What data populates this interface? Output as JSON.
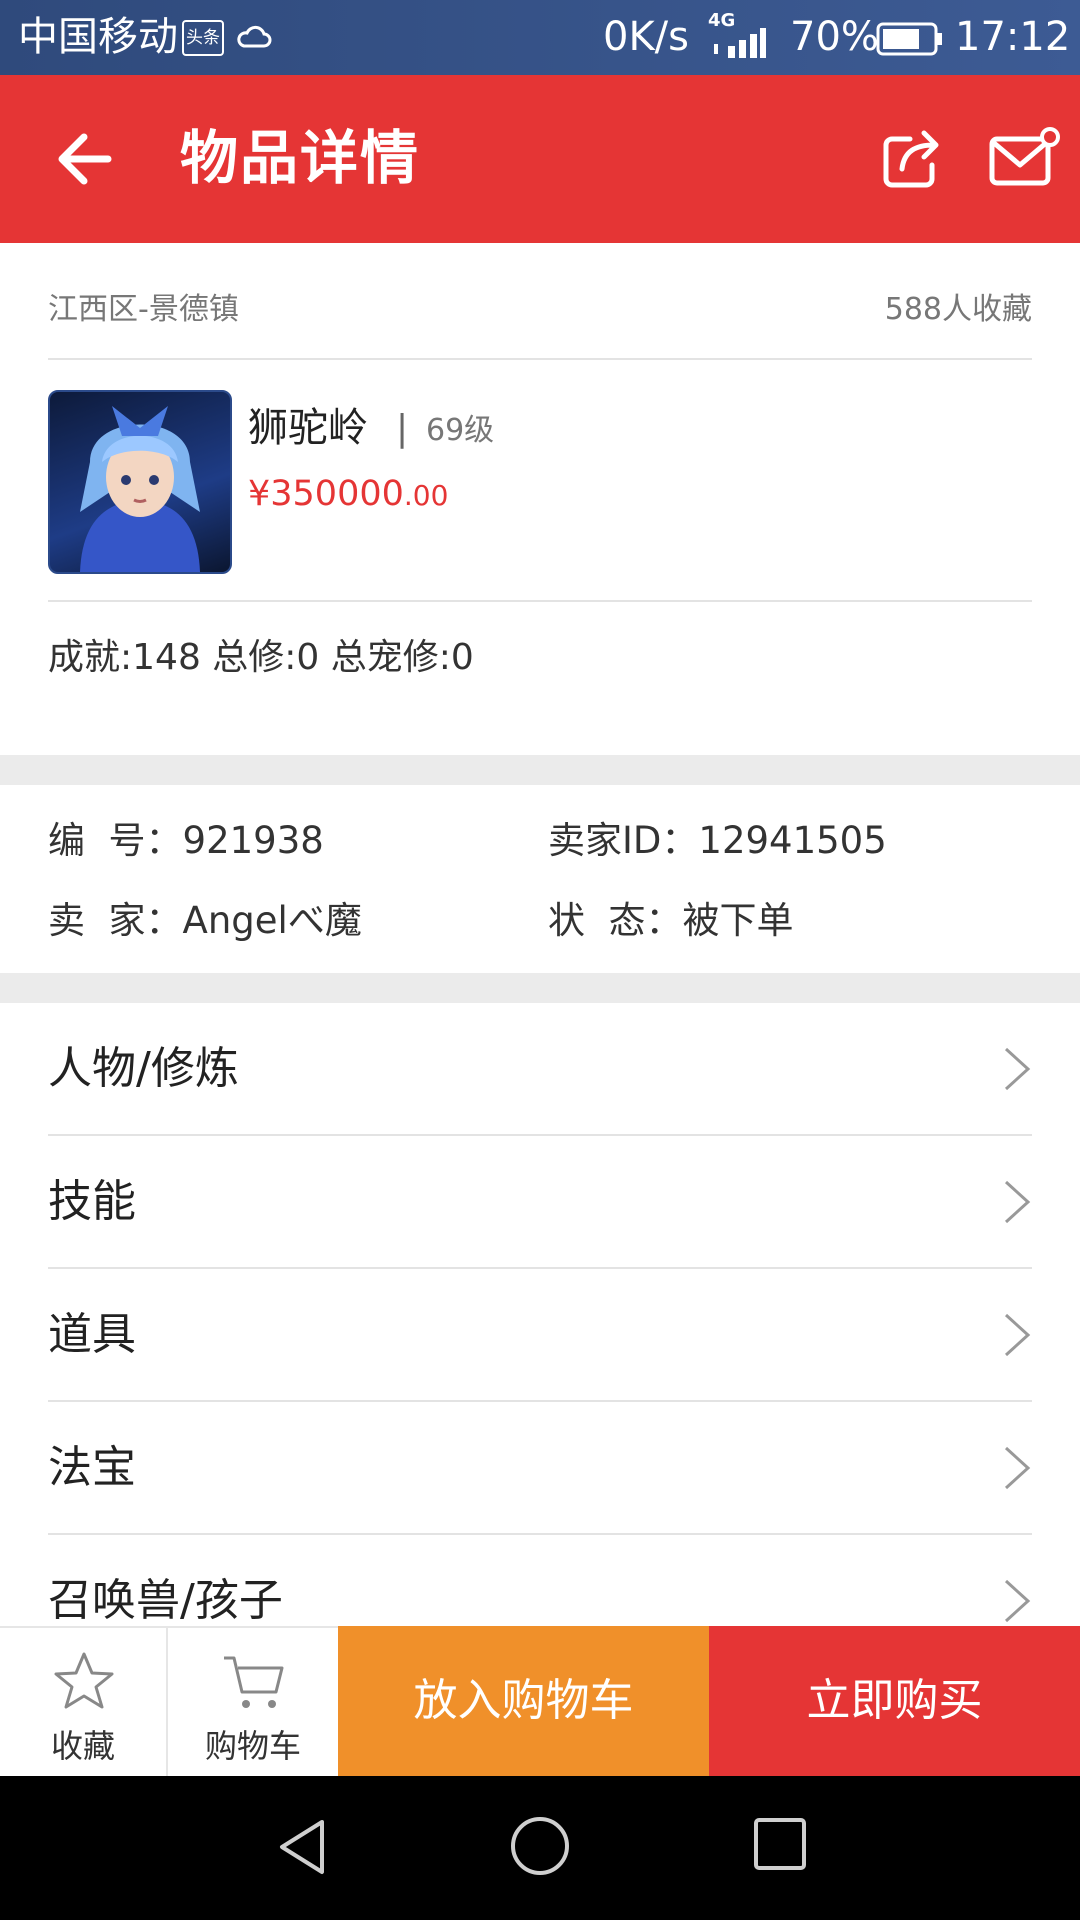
{
  "status_bar": {
    "carrier": "中国移动",
    "carrier_badge": "头条",
    "net_speed": "0K/s",
    "network": "4G",
    "battery": "70%",
    "time": "17:12"
  },
  "header": {
    "title": "物品详情",
    "icons": [
      "back-arrow-icon",
      "share-icon",
      "mail-icon"
    ]
  },
  "item": {
    "server": "江西区-景德镇",
    "favorites": "588人收藏",
    "school": "狮驼岭",
    "separator": "|",
    "level": "69级",
    "price_main": "¥350000",
    "price_decimal": ".00",
    "stats": "成就:148 总修:0 总宠修:0"
  },
  "info": {
    "id_label": "编  号：",
    "id_value": "921938",
    "seller_id_label": "卖家ID：",
    "seller_id_value": "12941505",
    "seller_label": "卖  家：",
    "seller_value": "Angelべ魔",
    "status_label": "状  态：",
    "status_value": "被下单"
  },
  "menu": [
    {
      "label": "人物/修炼"
    },
    {
      "label": "技能"
    },
    {
      "label": "道具"
    },
    {
      "label": "法宝"
    },
    {
      "label": "召唤兽/孩子"
    }
  ],
  "bottom_bar": {
    "favorite_label": "收藏",
    "cart_label": "购物车",
    "add_to_cart": "放入购物车",
    "buy_now": "立即购买"
  },
  "colors": {
    "primary_red": "#e53535",
    "orange": "#f0902a",
    "price_red": "#e53535"
  }
}
